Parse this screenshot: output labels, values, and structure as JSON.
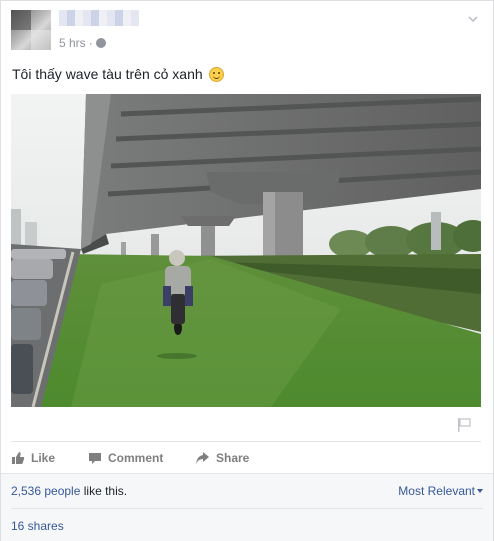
{
  "post": {
    "author": {
      "name": "",
      "avatar_icon": "avatar-blurred"
    },
    "meta": {
      "time": "5 hrs",
      "separator": "·",
      "privacy_icon": "globe-icon"
    },
    "text": "Tôi thấy wave tàu trên cỏ xanh",
    "emoji_icon": "smiley-emoji-icon",
    "photo_icon": "photo-motorbike-under-overpass",
    "report_icon": "flag-icon"
  },
  "actions": {
    "like": "Like",
    "comment": "Comment",
    "share": "Share"
  },
  "footer": {
    "likes_count": "2,536 people",
    "likes_suffix": " like this.",
    "sort_label": "Most Relevant",
    "shares": "16 shares"
  },
  "colors": {
    "link": "#365899",
    "meta": "#90949c",
    "action": "#7f7f7f",
    "footer_bg": "#f6f7f9"
  }
}
